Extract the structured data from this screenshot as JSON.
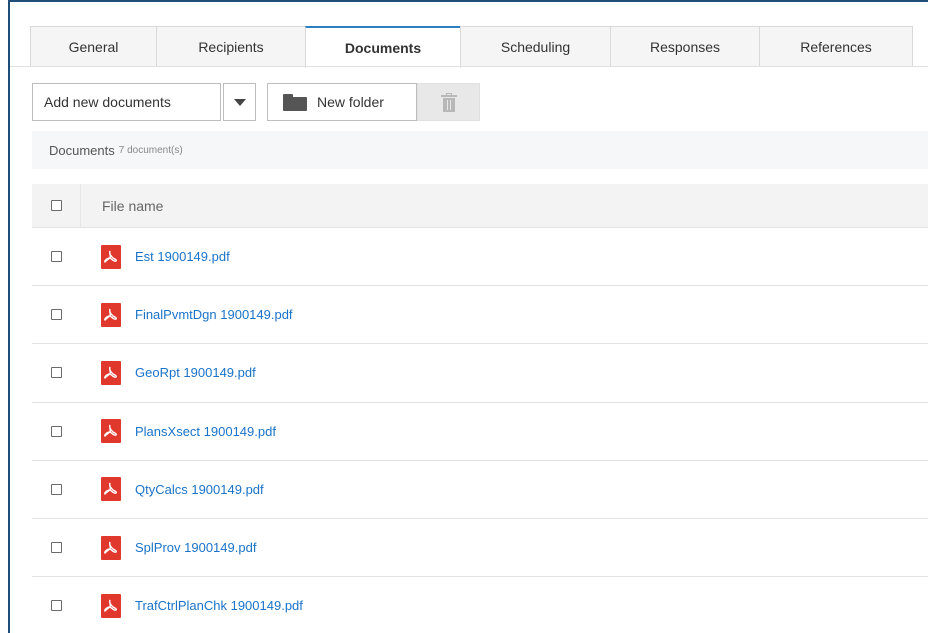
{
  "tabs": [
    {
      "label": "General",
      "active": false
    },
    {
      "label": "Recipients",
      "active": false
    },
    {
      "label": "Documents",
      "active": true
    },
    {
      "label": "Scheduling",
      "active": false
    },
    {
      "label": "Responses",
      "active": false
    },
    {
      "label": "References",
      "active": false
    }
  ],
  "toolbar": {
    "add_label": "Add new documents",
    "new_folder_label": "New folder"
  },
  "section": {
    "title": "Documents",
    "count": "7 document(s)"
  },
  "table": {
    "header_filename": "File name",
    "rows": [
      {
        "name": "Est 1900149.pdf"
      },
      {
        "name": "FinalPvmtDgn 1900149.pdf"
      },
      {
        "name": "GeoRpt 1900149.pdf"
      },
      {
        "name": "PlansXsect 1900149.pdf"
      },
      {
        "name": "QtyCalcs 1900149.pdf"
      },
      {
        "name": "SplProv 1900149.pdf"
      },
      {
        "name": "TrafCtrlPlanChk 1900149.pdf"
      }
    ]
  },
  "icons": {
    "file": "pdf-icon",
    "folder": "folder-icon",
    "delete": "trash-icon",
    "dropdown": "caret-down-icon"
  },
  "colors": {
    "active_tab_accent": "#2c7fbf",
    "link": "#1a73c8",
    "pdf": "#e0382d"
  }
}
